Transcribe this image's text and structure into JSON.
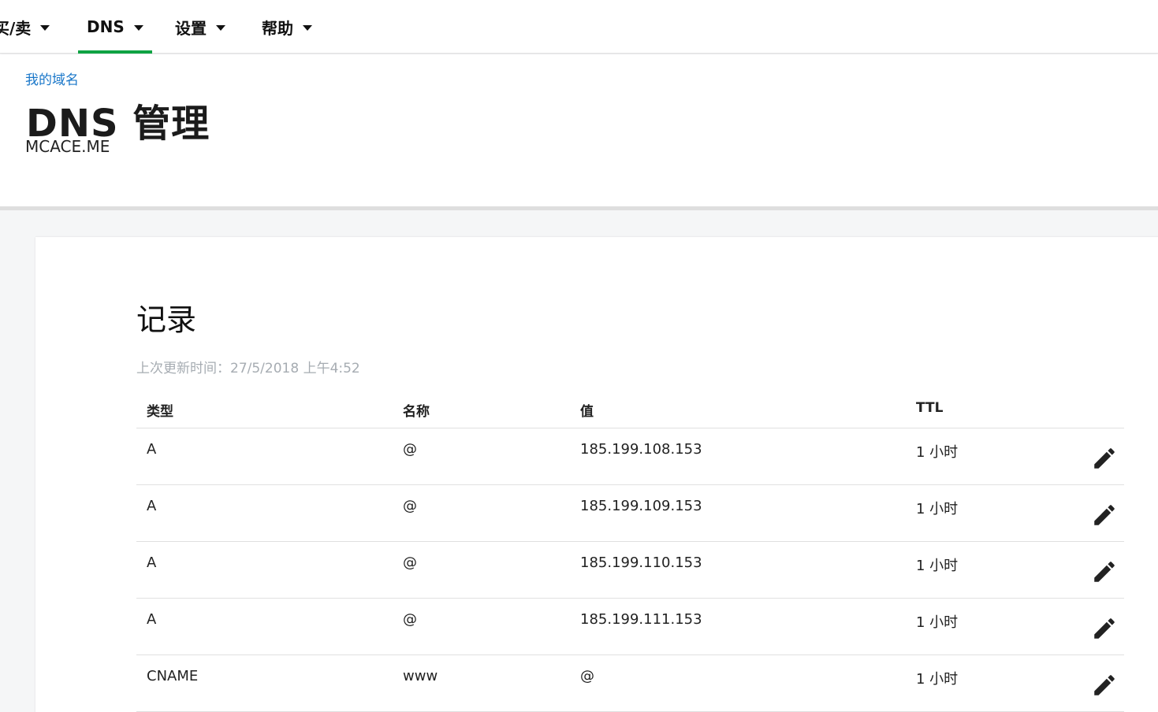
{
  "nav": {
    "items": [
      {
        "label": "买/卖"
      },
      {
        "label": "DNS",
        "active": true
      },
      {
        "label": "设置"
      },
      {
        "label": "帮助"
      }
    ],
    "accent_color": "#0fa343"
  },
  "header": {
    "breadcrumb": "我的域名",
    "title": "DNS 管理",
    "domain": "MCACE.ME"
  },
  "records": {
    "title": "记录",
    "last_updated": "上次更新时间：27/5/2018 上午4:52",
    "columns": [
      "类型",
      "名称",
      "值",
      "TTL"
    ],
    "rows": [
      {
        "type": "A",
        "name": "@",
        "value": "185.199.108.153",
        "ttl": "1 小时",
        "action_icon": "pencil-icon"
      },
      {
        "type": "A",
        "name": "@",
        "value": "185.199.109.153",
        "ttl": "1 小时",
        "action_icon": "pencil-icon"
      },
      {
        "type": "A",
        "name": "@",
        "value": "185.199.110.153",
        "ttl": "1 小时",
        "action_icon": "pencil-icon"
      },
      {
        "type": "A",
        "name": "@",
        "value": "185.199.111.153",
        "ttl": "1 小时",
        "action_icon": "pencil-icon"
      },
      {
        "type": "CNAME",
        "name": "www",
        "value": "@",
        "ttl": "1 小时",
        "action_icon": "pencil-icon"
      }
    ]
  },
  "colors": {
    "link": "#1a77c9",
    "muted": "#a6acb2",
    "page_bg": "#f5f6f7"
  }
}
